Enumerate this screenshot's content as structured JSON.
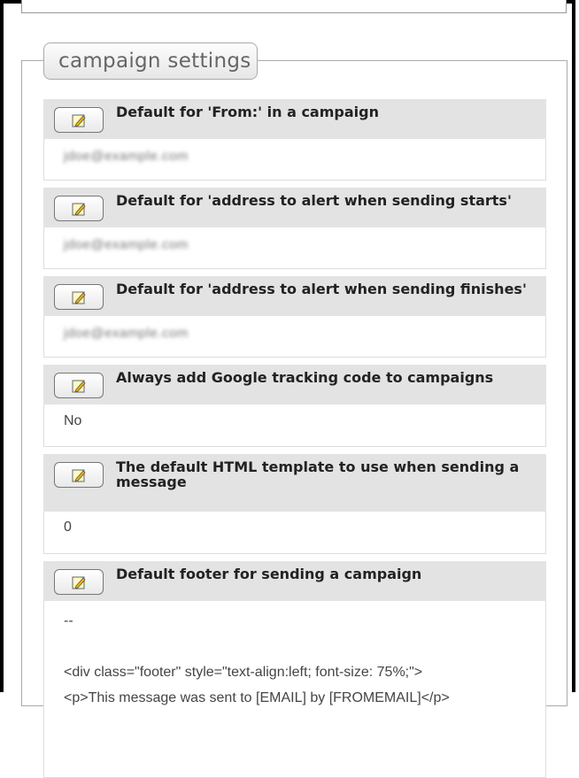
{
  "section_title": "campaign settings",
  "settings": [
    {
      "title": "Default for 'From:' in a campaign",
      "value": "jdoe@example.com"
    },
    {
      "title": "Default for 'address to alert when sending starts'",
      "value": "jdoe@example.com"
    },
    {
      "title": "Default for 'address to alert when sending finishes'",
      "value": "jdoe@example.com"
    },
    {
      "title": "Always add Google tracking code to campaigns",
      "value": "No"
    },
    {
      "title": "The default HTML template to use when sending a message",
      "value": "0"
    },
    {
      "title": "Default footer for sending a campaign",
      "value_lines": [
        "--",
        "",
        "<div class=\"footer\" style=\"text-align:left; font-size: 75%;\">",
        "<p>This message was sent to [EMAIL] by [FROMEMAIL]</p>"
      ]
    }
  ],
  "icons": {
    "edit": "edit-icon"
  }
}
